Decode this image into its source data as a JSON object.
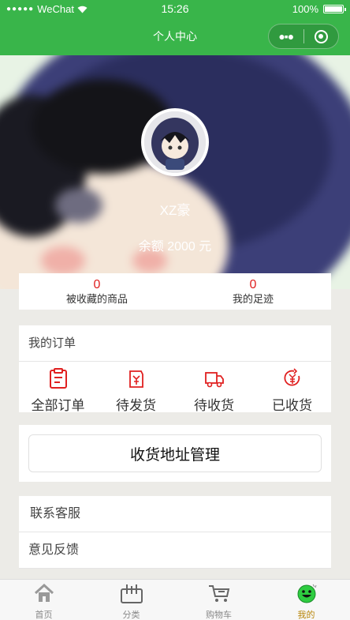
{
  "status_bar": {
    "carrier": "WeChat",
    "time": "15:26",
    "battery": "100%"
  },
  "nav": {
    "title": "个人中心"
  },
  "profile": {
    "username": "XZ豪",
    "balance": "余额 2000 元"
  },
  "stats": [
    {
      "count": "0",
      "label": "被收藏的商品"
    },
    {
      "count": "0",
      "label": "我的足迹"
    }
  ],
  "orders": {
    "title": "我的订单",
    "items": [
      {
        "label": "全部订单",
        "icon": "order-list-icon"
      },
      {
        "label": "待发货",
        "icon": "pending-ship-icon"
      },
      {
        "label": "待收货",
        "icon": "delivery-truck-icon"
      },
      {
        "label": "已收货",
        "icon": "received-yuan-icon"
      }
    ]
  },
  "address": {
    "label": "收货地址管理"
  },
  "links": [
    {
      "label": "联系客服"
    },
    {
      "label": "意见反馈"
    }
  ],
  "tabbar": [
    {
      "label": "首页",
      "icon": "home-icon",
      "active": false
    },
    {
      "label": "分类",
      "icon": "category-icon",
      "active": false
    },
    {
      "label": "购物车",
      "icon": "cart-icon",
      "active": false
    },
    {
      "label": "我的",
      "icon": "smiley-icon",
      "active": true
    }
  ],
  "colors": {
    "brand_green": "#39b54a",
    "accent_red": "#e02020",
    "active_tab": "#b8860b",
    "page_bg": "#ecebe7"
  }
}
